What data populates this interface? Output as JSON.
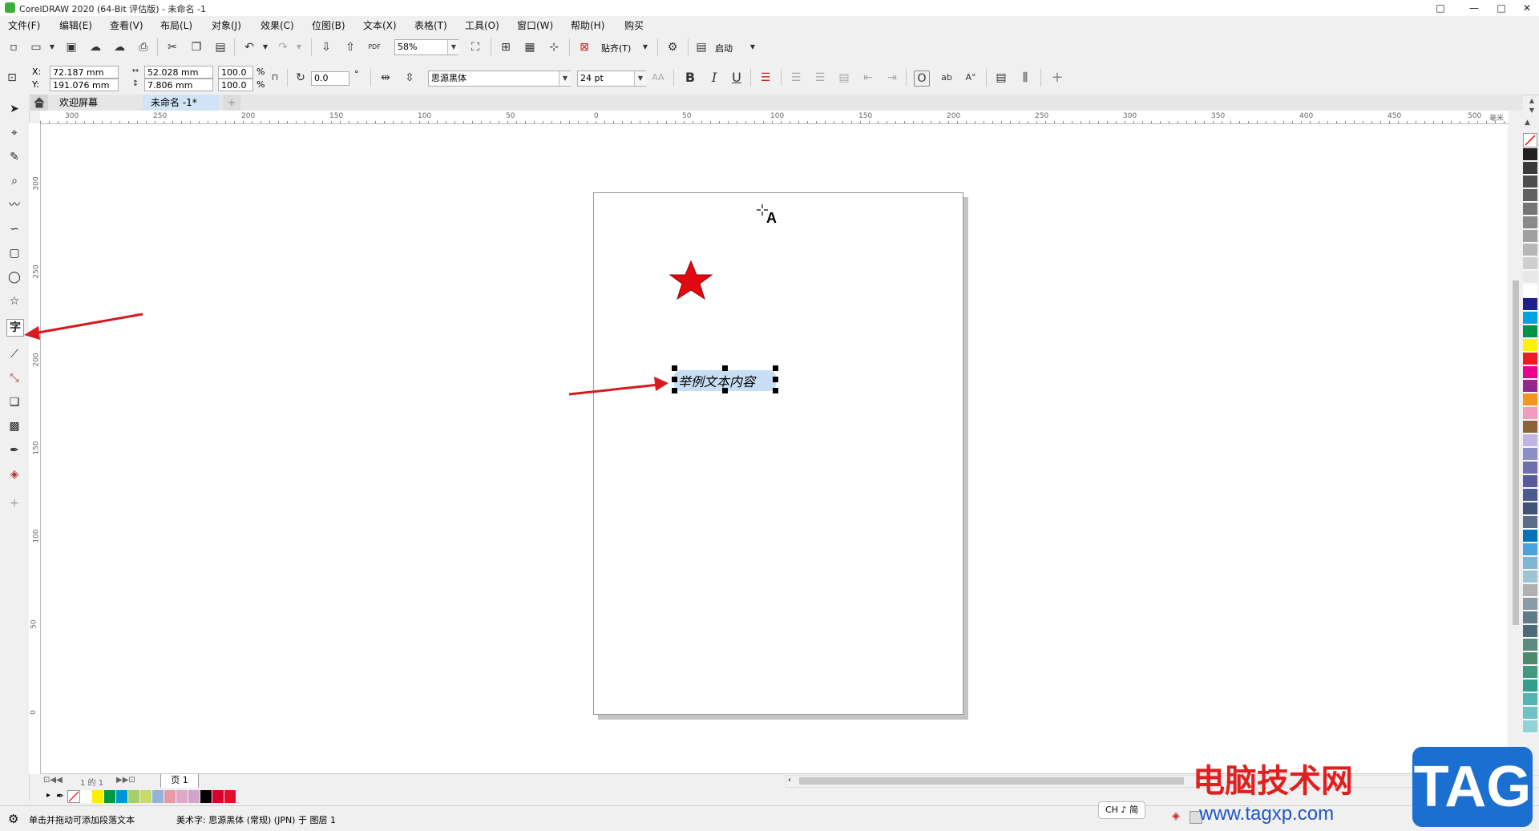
{
  "window": {
    "title": "CorelDRAW 2020 (64-Bit 评估版) - 未命名 -1",
    "controls": [
      "□",
      "—",
      "□",
      "✕"
    ]
  },
  "menu": [
    "文件(F)",
    "编辑(E)",
    "查看(V)",
    "布局(L)",
    "对象(J)",
    "效果(C)",
    "位图(B)",
    "文本(X)",
    "表格(T)",
    "工具(O)",
    "窗口(W)",
    "帮助(H)",
    "购买"
  ],
  "toolbar": {
    "zoom": "58%",
    "snap_label": "贴齐(T)",
    "launch_label": "启动"
  },
  "property_bar": {
    "x_label": "X:",
    "y_label": "Y:",
    "x_value": "72.187 mm",
    "y_value": "191.076 mm",
    "width_value": "52.028 mm",
    "height_value": "7.806 mm",
    "scale_x": "100.0",
    "scale_y": "100.0",
    "percent": "%",
    "rotation": "0.0",
    "degree": "°",
    "font_name": "思源黑体",
    "font_size": "24 pt",
    "bold": "B",
    "italic": "I",
    "underline": "U"
  },
  "tabs": {
    "home_icon": "home-icon",
    "welcome": "欢迎屏幕",
    "document": "未命名 -1*",
    "add": "+"
  },
  "ruler": {
    "h_ticks": [
      "300",
      "250",
      "200",
      "150",
      "100",
      "50",
      "0",
      "50",
      "100",
      "150",
      "200",
      "250",
      "300",
      "350",
      "400",
      "450",
      "500",
      "毫米"
    ],
    "v_ticks": [
      "300",
      "250",
      "200",
      "150",
      "100",
      "50",
      "0"
    ]
  },
  "canvas": {
    "text_content": "举例文本内容",
    "cursor_letter": "A"
  },
  "page_nav": {
    "counter": "1 的 1",
    "page_tab": "页 1"
  },
  "doc_palette_colors": [
    "#ffffff",
    "#ffef00",
    "#009a44",
    "#0096d6",
    "#a4d067",
    "#c8d96c",
    "#93b4d8",
    "#e59aa8",
    "#e0a7c9",
    "#d2a4c9",
    "#000000",
    "#d6002a",
    "#e30d2a"
  ],
  "palette_colors": [
    "#231f20",
    "#3a3a3a",
    "#4d4d4d",
    "#616161",
    "#757575",
    "#8a8a8a",
    "#a0a0a0",
    "#b7b7b7",
    "#cfcfcf",
    "#e8e8e8",
    "#ffffff",
    "#20208c",
    "#00a3e0",
    "#009245",
    "#fff200",
    "#ed1c24",
    "#ec008c",
    "#92278f",
    "#f7941d",
    "#f49ac1",
    "#8c6239",
    "#c2b5e6",
    "#8b8fc8",
    "#6d6fb0",
    "#585b9c",
    "#4d5a8f",
    "#3e5477",
    "#5a6e8a",
    "#0071bc",
    "#4aa3df",
    "#7fb6d3",
    "#9cc4d4",
    "#b0b0b0",
    "#8a9ba8",
    "#607c8a",
    "#4b6b7a",
    "#5c8a80",
    "#4c8a6e",
    "#3f9a7f",
    "#2fa08a",
    "#55b3b3",
    "#6fc3c8",
    "#8fd3d6"
  ],
  "status": {
    "hint": "单击并拖动可添加段落文本",
    "object_info": "美术字: 思源黑体 (常规) (JPN) 于 图层 1",
    "ime": "CH ♪ 简"
  },
  "watermark": {
    "cn": "电脑技术网",
    "url": "www.tagxp.com",
    "logo": "TAG"
  }
}
